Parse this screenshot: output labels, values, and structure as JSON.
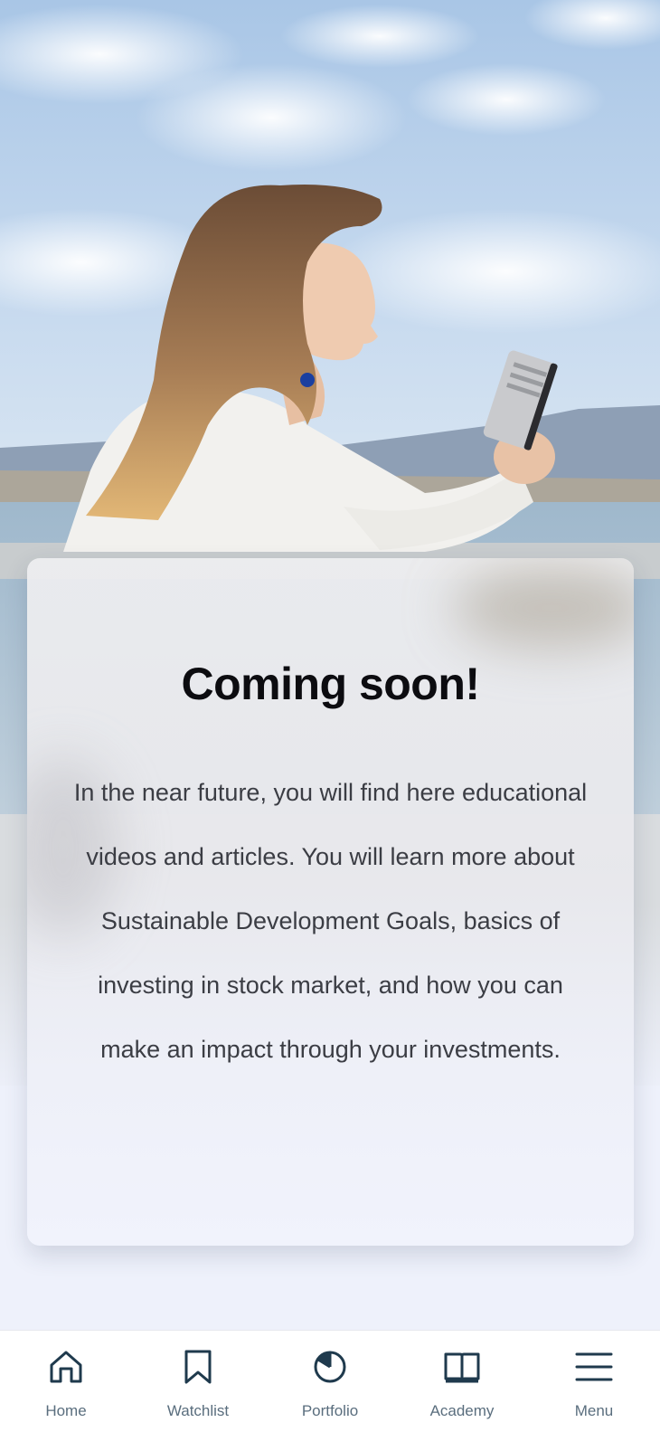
{
  "hero": {
    "image": "woman-looking-at-phone-by-seaside-photo"
  },
  "card": {
    "title": "Coming soon!",
    "body": "In the near future, you will find here educational videos and articles. You will learn more about Sustainable Development Goals, basics of investing in stock market, and how you can make an impact through your investments."
  },
  "nav": {
    "items": [
      {
        "label": "Home",
        "icon": "home-icon"
      },
      {
        "label": "Watchlist",
        "icon": "bookmark-icon"
      },
      {
        "label": "Portfolio",
        "icon": "pie-chart-icon"
      },
      {
        "label": "Academy",
        "icon": "open-book-icon"
      },
      {
        "label": "Menu",
        "icon": "hamburger-menu-icon"
      }
    ]
  },
  "colors": {
    "icon": "#1f3a4d",
    "label": "#5a6e7e",
    "title": "#0c0c10",
    "body_text": "#3b3d44",
    "background": "#eef1fb"
  }
}
